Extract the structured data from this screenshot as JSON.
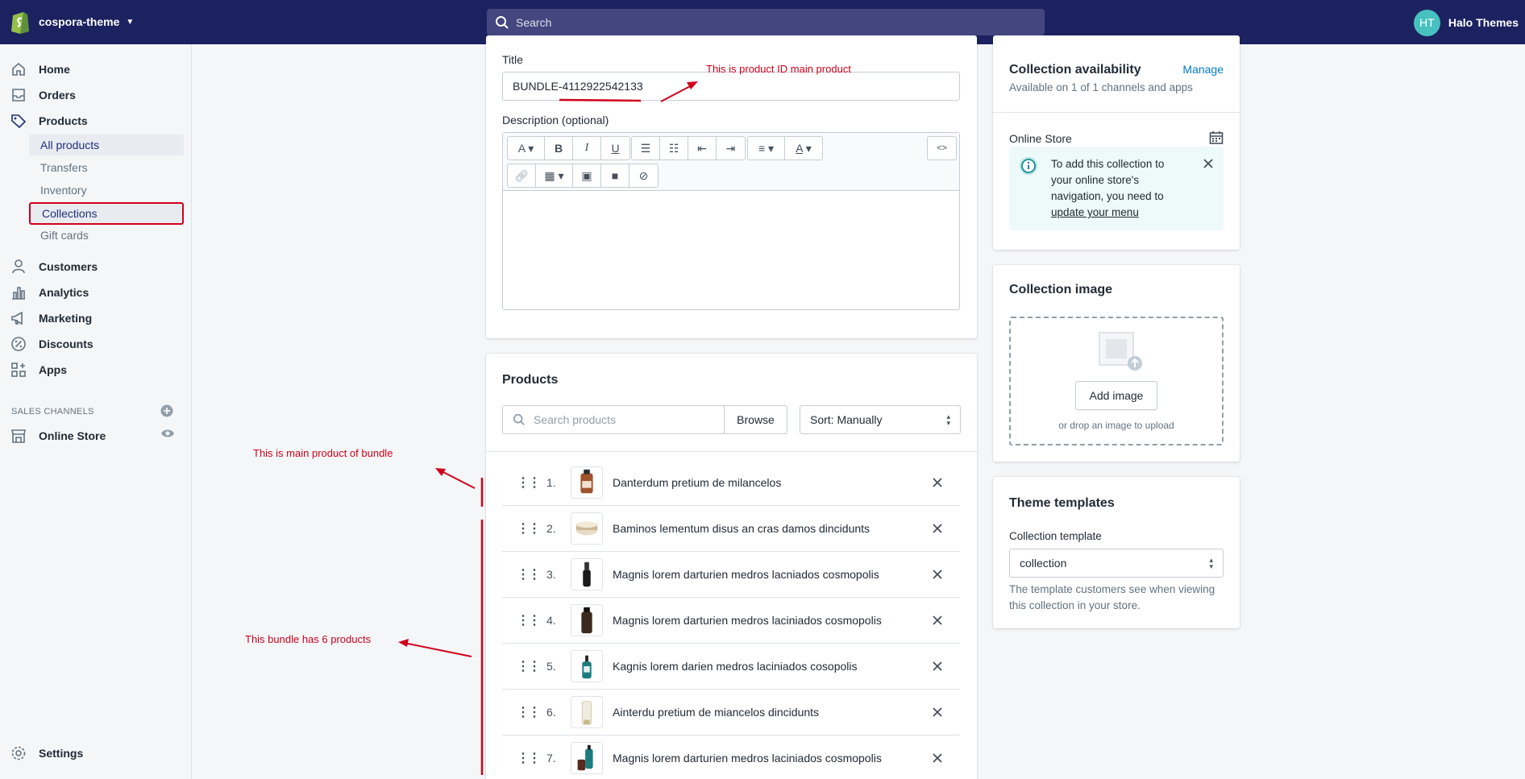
{
  "topbar": {
    "store_name": "cospora-theme",
    "search_placeholder": "Search",
    "user_initials": "HT",
    "user_name": "Halo Themes"
  },
  "sidebar": {
    "items": [
      {
        "label": "Home",
        "icon": "home-icon"
      },
      {
        "label": "Orders",
        "icon": "orders-icon"
      },
      {
        "label": "Products",
        "icon": "tag-icon"
      }
    ],
    "sub_items": [
      "All products",
      "Transfers",
      "Inventory",
      "Collections",
      "Gift cards"
    ],
    "items2": [
      {
        "label": "Customers",
        "icon": "person-icon"
      },
      {
        "label": "Analytics",
        "icon": "bar-chart-icon"
      },
      {
        "label": "Marketing",
        "icon": "megaphone-icon"
      },
      {
        "label": "Discounts",
        "icon": "discount-icon"
      },
      {
        "label": "Apps",
        "icon": "apps-icon"
      }
    ],
    "sales_channels_label": "SALES CHANNELS",
    "online_store": "Online Store",
    "settings": "Settings"
  },
  "main": {
    "title_label": "Title",
    "title_value": "BUNDLE-4112922542133",
    "description_label": "Description (optional)",
    "products_heading": "Products",
    "search_placeholder": "Search products",
    "browse_label": "Browse",
    "sort_label": "Sort: Manually",
    "products": [
      {
        "num": "1.",
        "name": "Danterdum pretium de milancelos",
        "thumb": "amber-bottle"
      },
      {
        "num": "2.",
        "name": "Baminos lementum disus an cras damos dincidunts",
        "thumb": "cream-jar"
      },
      {
        "num": "3.",
        "name": "Magnis lorem darturien medros lacniados cosmopolis",
        "thumb": "black-dropper"
      },
      {
        "num": "4.",
        "name": "Magnis lorem darturien medros laciniados cosmopolis",
        "thumb": "dark-bottle"
      },
      {
        "num": "5.",
        "name": "Kagnis lorem darien medros laciniados cosopolis",
        "thumb": "teal-pump"
      },
      {
        "num": "6.",
        "name": "Ainterdu pretium de miancelos dincidunts",
        "thumb": "white-tube"
      },
      {
        "num": "7.",
        "name": "Magnis lorem darturien medros laciniados cosmopolis",
        "thumb": "teal-set"
      }
    ]
  },
  "right": {
    "availability_title": "Collection availability",
    "manage_label": "Manage",
    "availability_text": "Available on 1 of 1 channels and apps",
    "online_store_label": "Online Store",
    "banner_lines": [
      "To add this collection to",
      "your online store's",
      "navigation, you need to"
    ],
    "banner_link": "update your menu",
    "image_title": "Collection image",
    "add_image_label": "Add image",
    "drop_text": "or drop an image to upload",
    "templates_title": "Theme templates",
    "template_label": "Collection template",
    "template_value": "collection",
    "template_help_1": "The template customers see when viewing",
    "template_help_2": "this collection in your store."
  },
  "annotations": {
    "product_id": "This is product ID main product",
    "main_product": "This is main product of bundle",
    "bundle_count": "This bundle has 6 products"
  },
  "colors": {
    "topbar": "#1c2260",
    "annotation_red": "#d0021b",
    "link_blue": "#007ace",
    "avatar_teal": "#47c1bf"
  }
}
